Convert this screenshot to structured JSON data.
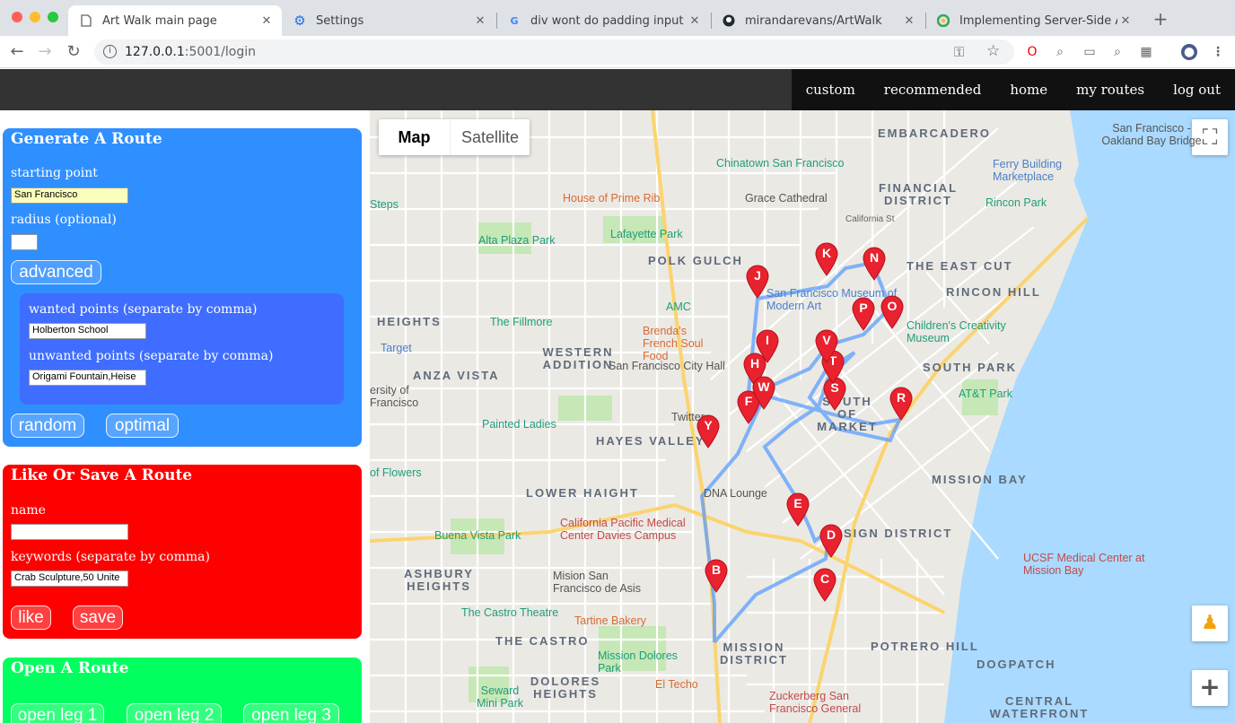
{
  "browser": {
    "tabs": [
      {
        "title": "Art Walk main page",
        "active": true,
        "favicon": "page-icon"
      },
      {
        "title": "Settings",
        "active": false,
        "favicon": "gear-icon"
      },
      {
        "title": "div wont do padding input - Go",
        "active": false,
        "favicon": "google-icon"
      },
      {
        "title": "mirandarevans/ArtWalk",
        "active": false,
        "favicon": "github-icon"
      },
      {
        "title": "Implementing Server-Side Auth",
        "active": false,
        "favicon": "site-icon"
      }
    ],
    "url_host": "127.0.0.1",
    "url_path": ":5001/login"
  },
  "nav": {
    "links": [
      "custom",
      "recommended",
      "home",
      "my routes",
      "log out"
    ]
  },
  "generate": {
    "title": "Generate A Route",
    "starting_label": "starting point",
    "starting_value": "San Francisco",
    "radius_label": "radius (optional)",
    "radius_value": "",
    "advanced_button": "advanced",
    "wanted_label": "wanted points (separate by comma)",
    "wanted_value": "Holberton School",
    "unwanted_label": "unwanted points (separate by comma)",
    "unwanted_value": "Origami Fountain,Heise",
    "random_button": "random",
    "optimal_button": "optimal"
  },
  "likesave": {
    "title": "Like Or Save A Route",
    "name_label": "name",
    "name_value": "",
    "keywords_label": "keywords (separate by comma)",
    "keywords_value": "Crab Sculpture,50 Unite",
    "like_button": "like",
    "save_button": "save"
  },
  "open": {
    "title": "Open A Route",
    "buttons": [
      "open leg 1",
      "open leg 2",
      "open leg 3"
    ]
  },
  "map": {
    "toggle": [
      "Map",
      "Satellite"
    ],
    "districts": [
      "EMBARCADERO",
      "FINANCIAL DISTRICT",
      "POLK GULCH",
      "THE EAST CUT",
      "RINCON HILL",
      "HEIGHTS",
      "WESTERN ADDITION",
      "ANZA VISTA",
      "SOUTH PARK",
      "SOUTH OF MARKET",
      "HAYES VALLEY",
      "LOWER HAIGHT",
      "MISSION BAY",
      "SIGN DISTRICT",
      "ASHBURY HEIGHTS",
      "THE CASTRO",
      "MISSION DISTRICT",
      "POTRERO HILL",
      "DOLORES HEIGHTS",
      "DOGPATCH",
      "CENTRAL WATERFRONT"
    ],
    "places": [
      "Chinatown San Francisco",
      "House of Prime Rib",
      "Grace Cathedral",
      "Ferry Building Marketplace",
      "San Francisco - Oakland Bay Bridge",
      "Rincon Park",
      "Alta Plaza Park",
      "Lafayette Park",
      "California St",
      "San Francisco Museum of Modern Art",
      "AMC",
      "The Fillmore",
      "Brenda's French Soul Food",
      "Children's Creativity Museum",
      "Target",
      "San Francisco City Hall",
      "AT&T Park",
      "Painted Ladies",
      "Twitter",
      "DNA Lounge",
      "California Pacific Medical Center Davies Campus",
      "Buena Vista Park",
      "Mision San Francisco de Asis",
      "The Castro Theatre",
      "Tartine Bakery",
      "UCSF Medical Center at Mission Bay",
      "Mission Dolores Park",
      "Seward Mini Park",
      "El Techo",
      "Zuckerberg San Francisco General",
      "Steps",
      "of Flowers",
      "ersity of Francisco"
    ],
    "markers": [
      "B",
      "C",
      "D",
      "E",
      "F",
      "H",
      "I",
      "J",
      "K",
      "N",
      "O",
      "P",
      "R",
      "S",
      "T",
      "V",
      "W",
      "Y"
    ]
  }
}
